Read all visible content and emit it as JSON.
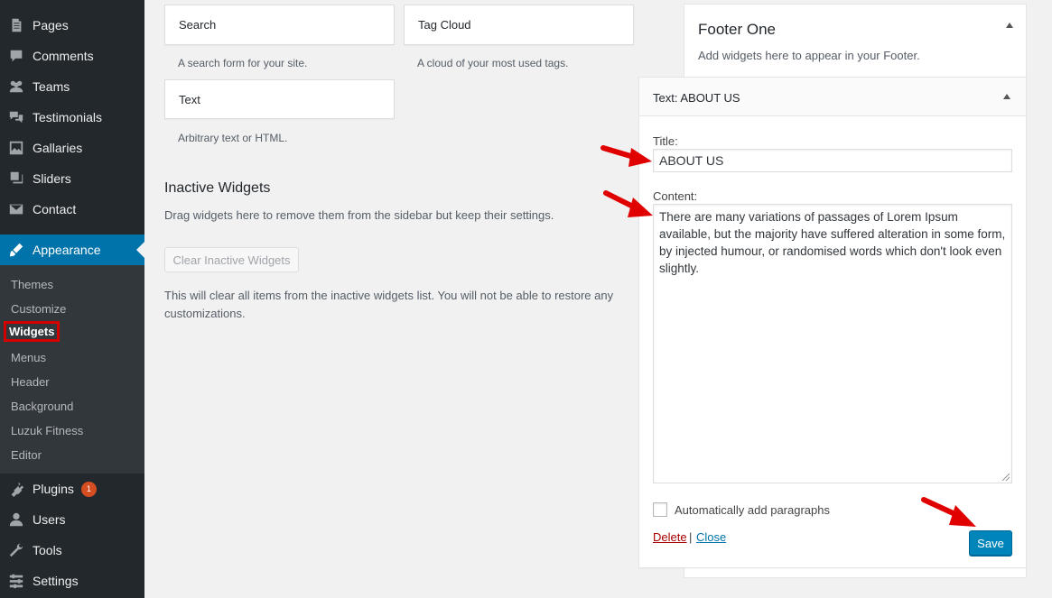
{
  "sidebar": {
    "items": [
      {
        "label": "Pages",
        "icon": "pages-icon"
      },
      {
        "label": "Comments",
        "icon": "comments-icon"
      },
      {
        "label": "Teams",
        "icon": "teams-icon"
      },
      {
        "label": "Testimonials",
        "icon": "testimonials-icon"
      },
      {
        "label": "Gallaries",
        "icon": "gallery-icon"
      },
      {
        "label": "Sliders",
        "icon": "sliders-icon"
      },
      {
        "label": "Contact",
        "icon": "contact-icon"
      },
      {
        "label": "Appearance",
        "icon": "appearance-icon"
      },
      {
        "label": "Plugins",
        "icon": "plugins-icon",
        "badge": "1"
      },
      {
        "label": "Users",
        "icon": "users-icon"
      },
      {
        "label": "Tools",
        "icon": "tools-icon"
      },
      {
        "label": "Settings",
        "icon": "settings-icon"
      }
    ],
    "submenu": [
      "Themes",
      "Customize",
      "Widgets",
      "Menus",
      "Header",
      "Background",
      "Luzuk Fitness",
      "Editor"
    ],
    "colors": {
      "bg": "#23282d",
      "active": "#0073aa",
      "submenu_bg": "#32373c",
      "highlight_border": "#d40000"
    }
  },
  "available_widgets": [
    {
      "name": "Search",
      "desc": "A search form for your site."
    },
    {
      "name": "Tag Cloud",
      "desc": "A cloud of your most used tags."
    },
    {
      "name": "Text",
      "desc": "Arbitrary text or HTML."
    }
  ],
  "inactive": {
    "title": "Inactive Widgets",
    "desc": "Drag widgets here to remove them from the sidebar but keep their settings.",
    "clear_label": "Clear Inactive Widgets",
    "note": "This will clear all items from the inactive widgets list. You will not be able to restore any customizations."
  },
  "footer_area": {
    "title": "Footer One",
    "desc": "Add widgets here to appear in your Footer."
  },
  "widget_form": {
    "header": "Text: ABOUT US",
    "title_label": "Title:",
    "title_value": "ABOUT US",
    "content_label": "Content:",
    "content_value": "There are many variations of passages of Lorem Ipsum available, but the majority have suffered alteration in some form, by injected humour, or randomised words which don't look even slightly.",
    "auto_paragraphs_label": "Automatically add paragraphs",
    "auto_paragraphs_checked": false,
    "delete_label": "Delete",
    "separator": "|",
    "close_label": "Close",
    "save_label": "Save",
    "save_color": "#0085ba"
  },
  "annotation_color": "#e00000"
}
